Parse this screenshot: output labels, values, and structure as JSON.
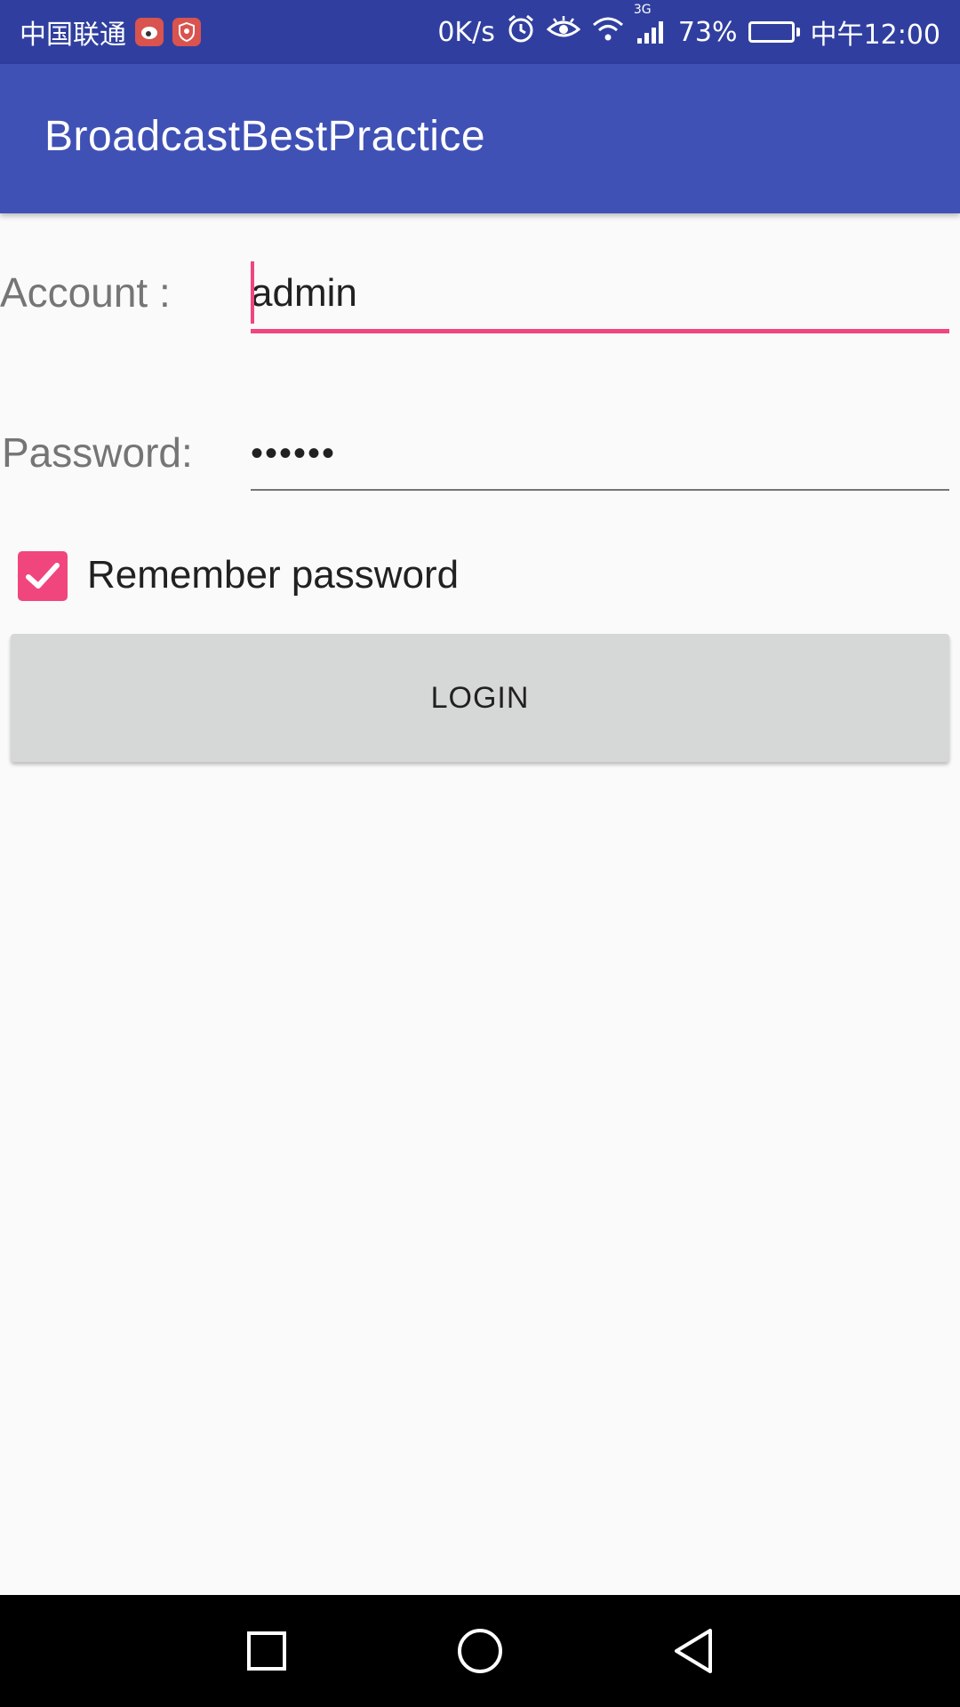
{
  "status_bar": {
    "carrier": "中国联通",
    "net_speed": "0K/s",
    "network_type": "3G",
    "battery_percent": "73%",
    "battery_level": 0.73,
    "time": "中午12:00",
    "icons": [
      "weibo-icon",
      "shield-app-icon",
      "alarm-icon",
      "eye-icon",
      "wifi-icon",
      "signal-icon",
      "battery-charging-icon"
    ]
  },
  "app_bar": {
    "title": "BroadcastBestPractice"
  },
  "form": {
    "account_label": "Account :",
    "account_value": "admin",
    "password_label": "Password:",
    "password_value": "••••••",
    "remember_label": "Remember password",
    "remember_checked": true,
    "login_label": "LOGIN"
  },
  "nav_bar": {
    "icons": [
      "recents-square-icon",
      "home-circle-icon",
      "back-triangle-icon"
    ]
  },
  "colors": {
    "status_bar": "#303f9f",
    "app_bar": "#3f51b5",
    "accent": "#f0467d",
    "button": "#d6d7d7",
    "background": "#fafafa"
  }
}
